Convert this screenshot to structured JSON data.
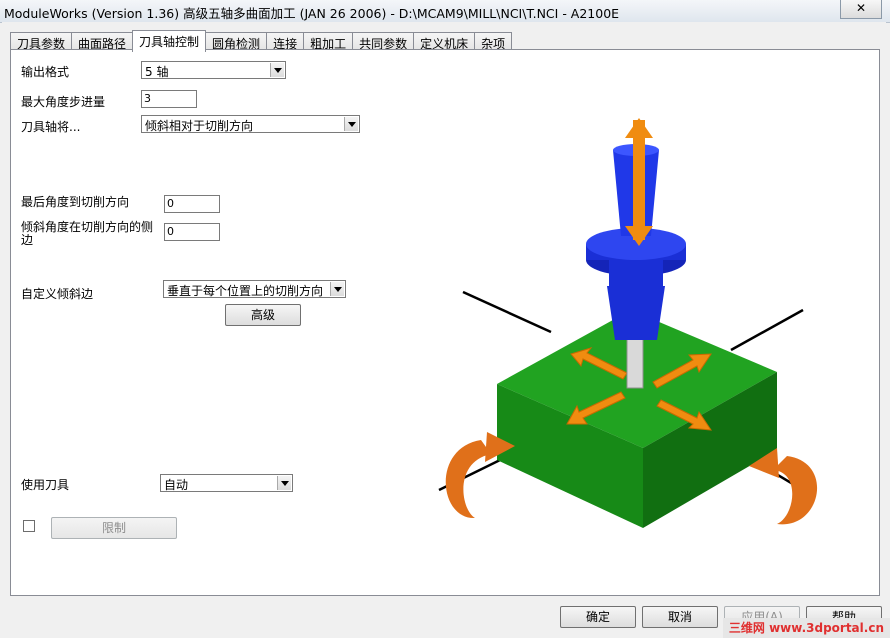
{
  "window": {
    "title": "ModuleWorks (Version 1.36) 高级五轴多曲面加工 (JAN 26 2006) - D:\\MCAM9\\MILL\\NCI\\T.NCI - A2100E",
    "close_glyph": "✕"
  },
  "tabs": [
    "刀具参数",
    "曲面路径",
    "刀具轴控制",
    "圆角检测",
    "连接",
    "粗加工",
    "共同参数",
    "定义机床",
    "杂项"
  ],
  "active_tab": "刀具轴控制",
  "form": {
    "output_format": {
      "label": "输出格式",
      "value": "5 轴"
    },
    "max_angle_step": {
      "label": "最大角度步进量",
      "value": "3"
    },
    "tool_axis": {
      "label": "刀具轴将...",
      "value": "倾斜相对于切削方向"
    },
    "last_angle": {
      "label": "最后角度到切削方向",
      "value": "0"
    },
    "tilt_angle": {
      "label": "倾斜角度在切削方向的侧边",
      "value": "0"
    },
    "custom_tilt": {
      "label": "自定义倾斜边",
      "value": "垂直于每个位置上的切削方向"
    },
    "advanced_button": "高级",
    "use_tool": {
      "label": "使用刀具",
      "value": "自动"
    },
    "limit_button": "限制",
    "limit_checked": false
  },
  "footer": {
    "ok": "确定",
    "cancel": "取消",
    "apply": "应用(A)",
    "help": "帮助"
  },
  "watermark": "三维网 www.3dportal.cn",
  "colors": {
    "tool_blue": "#1a2fd6",
    "block_green": "#1f9a1f",
    "arrow_orange": "#f08c10",
    "rotation_orange": "#e0701a"
  }
}
